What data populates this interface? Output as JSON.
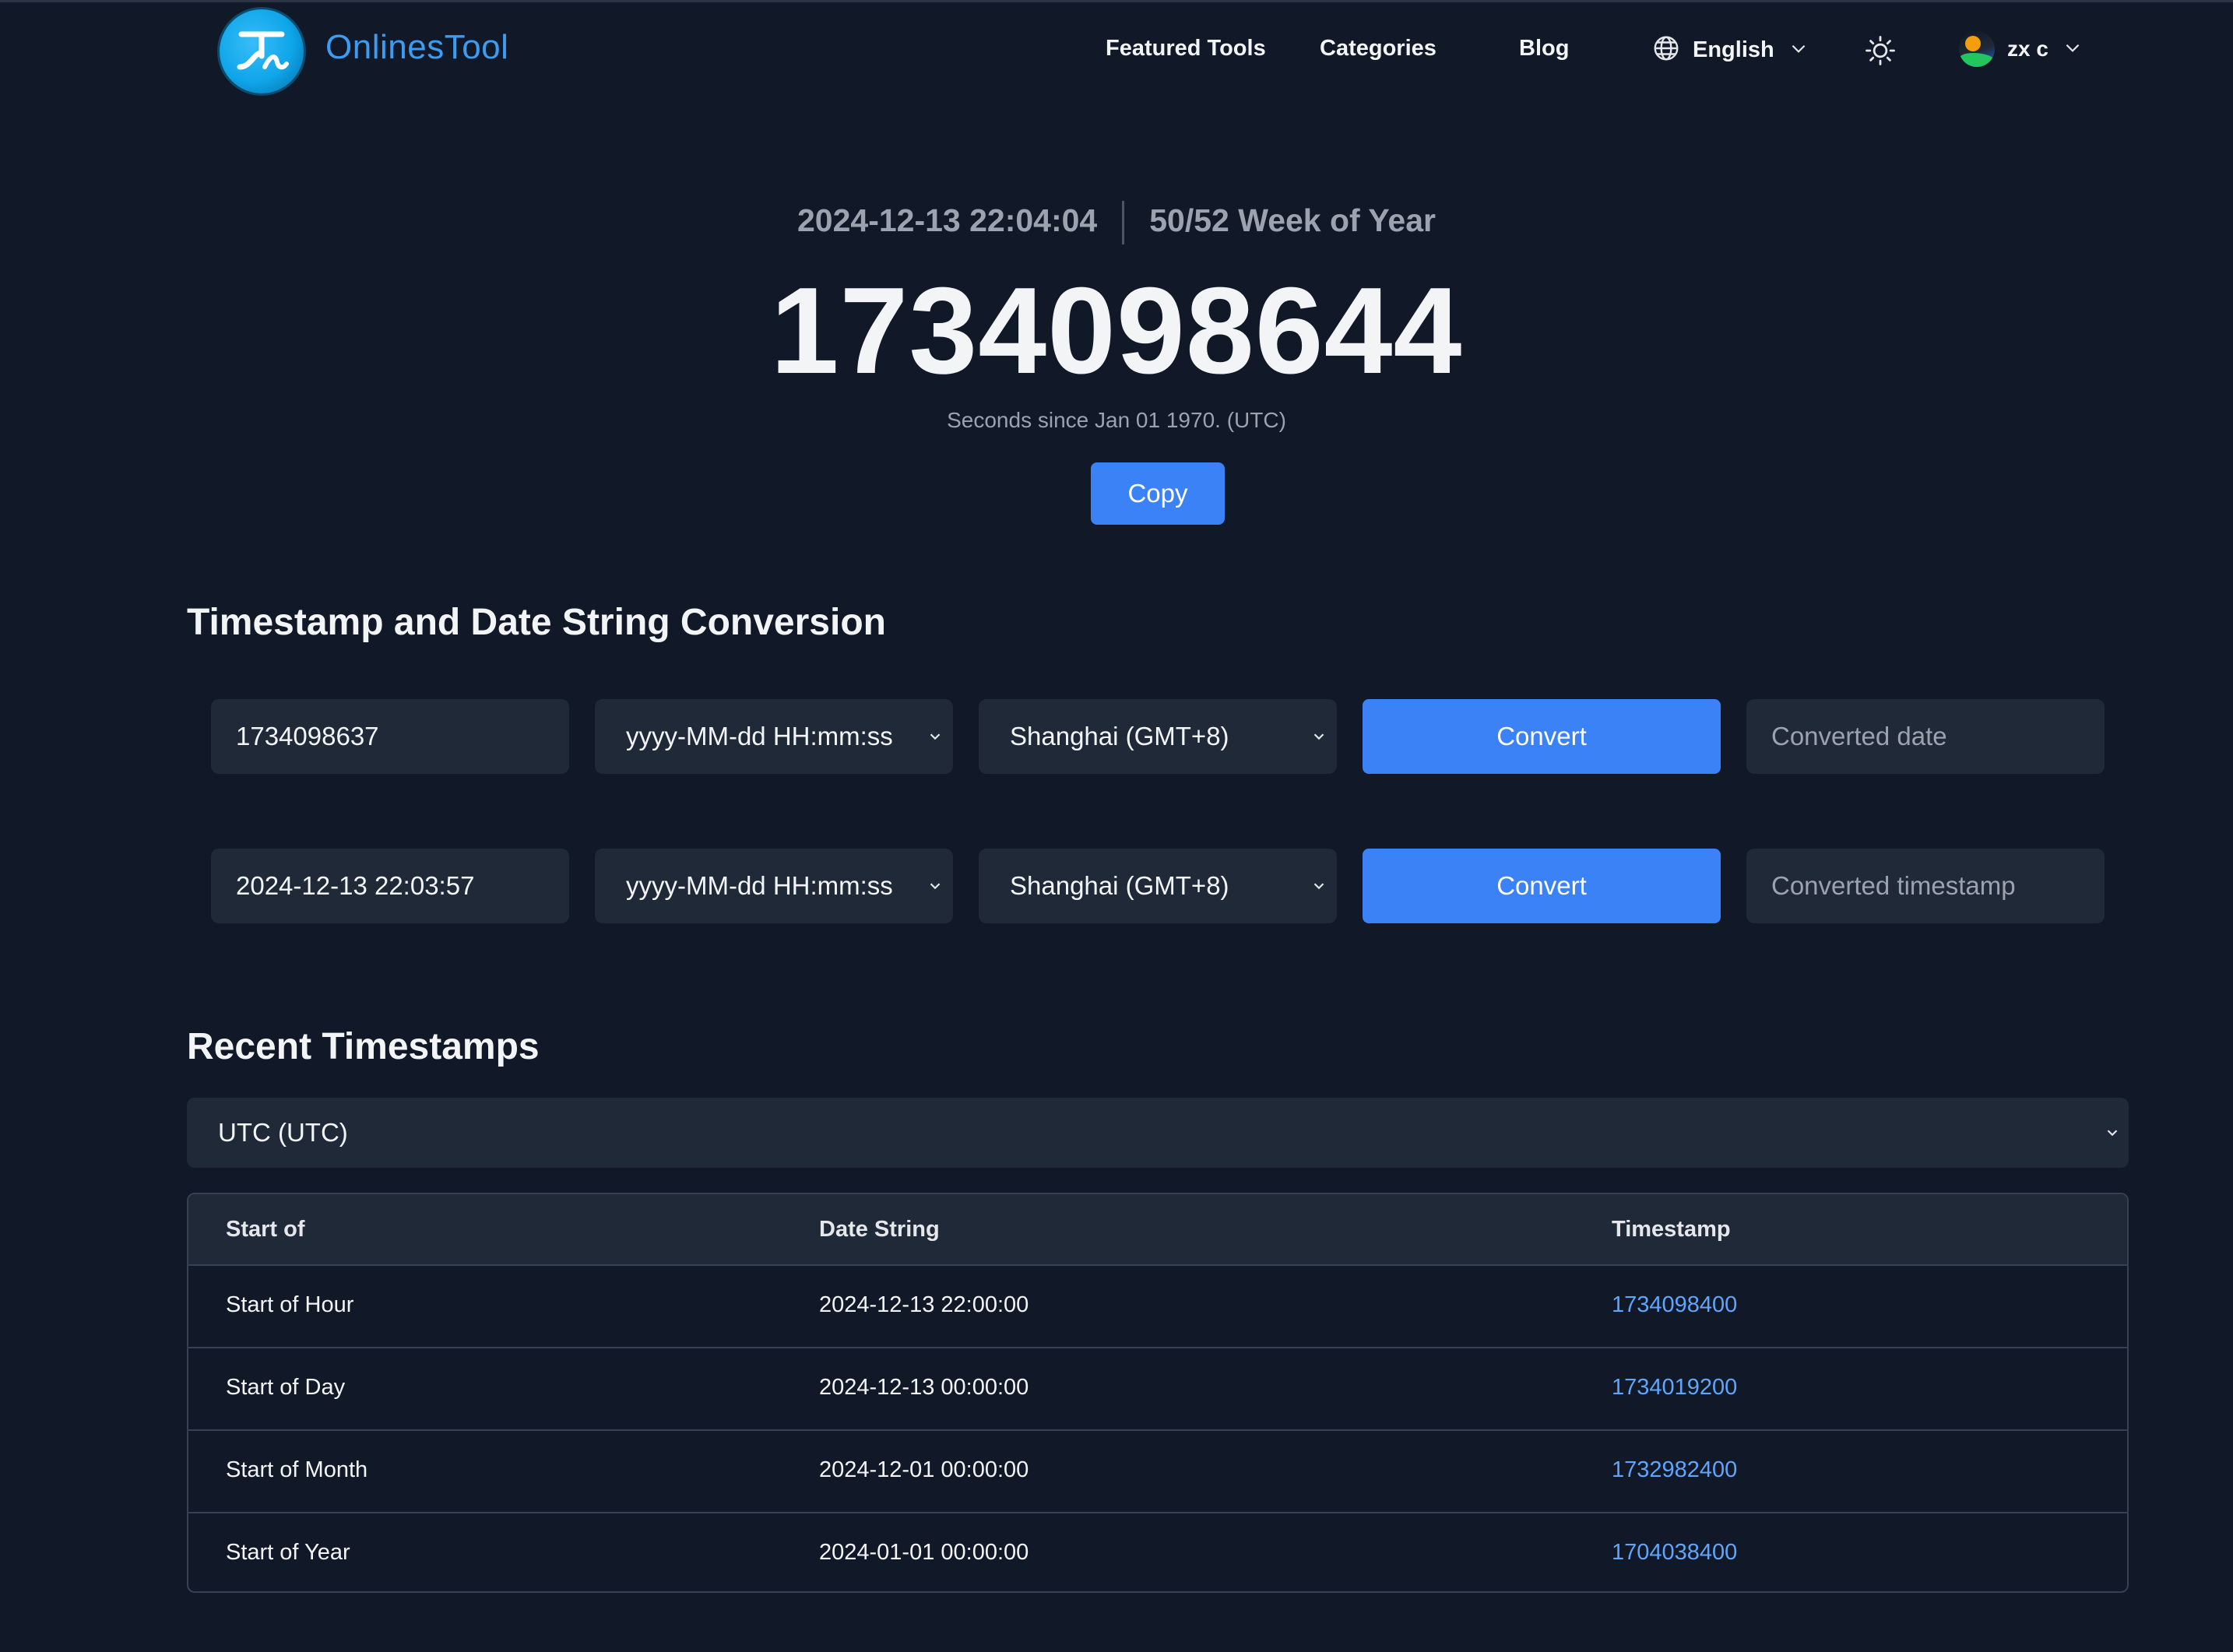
{
  "header": {
    "brand": "OnlinesTool",
    "nav": {
      "featured": "Featured Tools",
      "categories": "Categories",
      "blog": "Blog"
    },
    "language": "English",
    "user": "zx c"
  },
  "hero": {
    "date": "2024-12-13 22:04:04",
    "week": "50/52 Week of Year",
    "timestamp": "1734098644",
    "subtitle": "Seconds since Jan 01 1970. (UTC)",
    "copy_label": "Copy"
  },
  "conversion": {
    "title": "Timestamp and Date String Conversion",
    "row1": {
      "input": "1734098637",
      "format": "yyyy-MM-dd HH:mm:ss",
      "timezone": "Shanghai (GMT+8)",
      "button": "Convert",
      "output_placeholder": "Converted date"
    },
    "row2": {
      "input": "2024-12-13 22:03:57",
      "format": "yyyy-MM-dd HH:mm:ss",
      "timezone": "Shanghai (GMT+8)",
      "button": "Convert",
      "output_placeholder": "Converted timestamp"
    }
  },
  "recent": {
    "title": "Recent Timestamps",
    "timezone": "UTC (UTC)",
    "columns": [
      "Start of",
      "Date String",
      "Timestamp"
    ],
    "rows": [
      {
        "label": "Start of Hour",
        "date": "2024-12-13 22:00:00",
        "timestamp": "1734098400"
      },
      {
        "label": "Start of Day",
        "date": "2024-12-13 00:00:00",
        "timestamp": "1734019200"
      },
      {
        "label": "Start of Month",
        "date": "2024-12-01 00:00:00",
        "timestamp": "1732982400"
      },
      {
        "label": "Start of Year",
        "date": "2024-01-01 00:00:00",
        "timestamp": "1704038400"
      }
    ]
  },
  "icons": {
    "logo": "logo-icon",
    "language": "globe-icon",
    "theme": "sun-icon",
    "dropdown": "chevron-down-icon"
  },
  "colors": {
    "background": "#111827",
    "accent": "#3b82f6",
    "link": "#60a5fa",
    "brand": "#3b9cf0"
  }
}
